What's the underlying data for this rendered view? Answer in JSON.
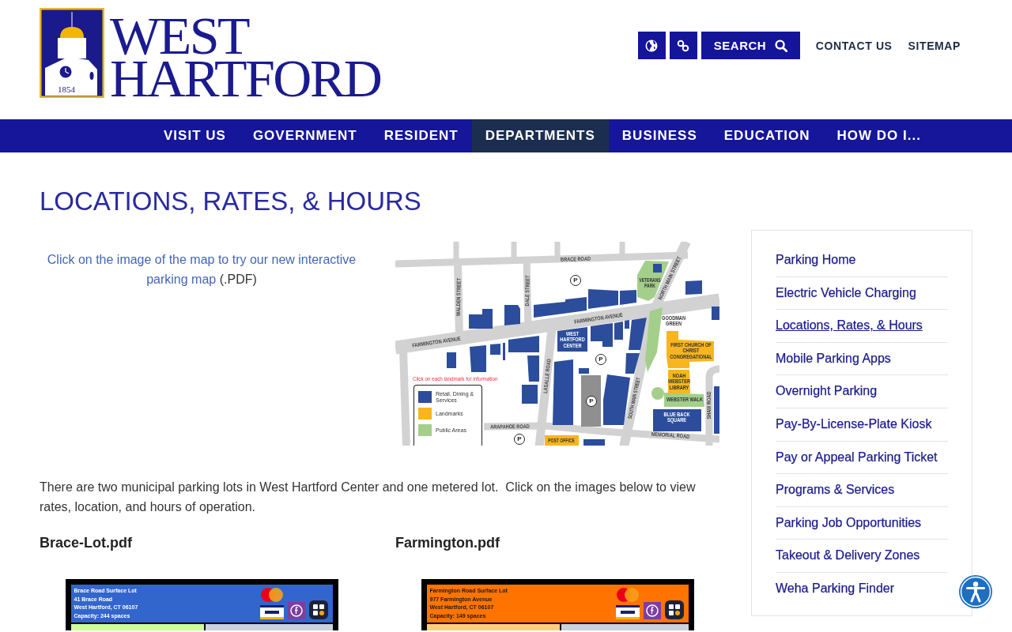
{
  "logo": {
    "line1": "WEST",
    "line2": "HARTFORD",
    "year": "1854"
  },
  "utility": {
    "search": "SEARCH",
    "links": [
      "CONTACT US",
      "SITEMAP"
    ]
  },
  "nav": [
    {
      "label": "VISIT US",
      "selected": false
    },
    {
      "label": "GOVERNMENT",
      "selected": false
    },
    {
      "label": "RESIDENT",
      "selected": false
    },
    {
      "label": "DEPARTMENTS",
      "selected": true
    },
    {
      "label": "BUSINESS",
      "selected": false
    },
    {
      "label": "EDUCATION",
      "selected": false
    },
    {
      "label": "HOW DO I...",
      "selected": false
    }
  ],
  "page_title": "LOCATIONS, RATES, & HOURS",
  "map_intro": {
    "link_lines": [
      "Click on the image of the map to try our new interactive",
      "parking map"
    ],
    "suffix": "(.PDF)"
  },
  "map": {
    "labels": [
      "BRACE ROAD",
      "WALDEN STREET",
      "DALE STREET",
      "VETERANS PARK",
      "NORTH MAIN STREET",
      "FARMINGTON AVENUE",
      "GOODMAN GREEN",
      "FARMINGTON AVENUE",
      "WEST HARTFORD CENTER",
      "FIRST CHURCH OF CHRIST CONGREGATIONAL",
      "LASALLE ROAD",
      "SOUTH MAIN STREET",
      "NOAH WEBSTER LIBRARY",
      "WEBSTER WALK",
      "BLUE BACK SQUARE",
      "SHAW ROAD",
      "ARAPAHOE ROAD",
      "MEMORIAL ROAD",
      "POST OFFICE"
    ],
    "parking_markers": [
      "P",
      "P",
      "P",
      "P"
    ],
    "note": "Click on each landmark for information",
    "legend": [
      {
        "label": "Retail, Dining & Services",
        "color": "#2b4d9b"
      },
      {
        "label": "Landmarks",
        "color": "#f8b51c"
      },
      {
        "label": "Public Areas",
        "color": "#a3cf8a"
      }
    ]
  },
  "description": "There are two municipal parking lots in West Hartford Center and one metered lot.  Click on the images below to view rates, location, and hours of operation.",
  "documents": [
    {
      "file": "Brace-Lot.pdf",
      "color": "#3366cc",
      "panel": {
        "color": "#ccff99"
      },
      "lines": [
        "Brace Road Surface Lot",
        "41 Brace Road",
        "West Hartford, CT 06107",
        "Capacity:  244 spaces"
      ]
    },
    {
      "file": "Farmington.pdf",
      "color": "#ff7300",
      "panel": {
        "color": "#ffcc80"
      },
      "lines": [
        "Farmington Road Surface Lot",
        "977 Farmington Avenue",
        "West Hartford, CT 06107",
        "Capacity:  149 spaces"
      ]
    }
  ],
  "sidebar": [
    {
      "label": "Parking Home",
      "selected": false
    },
    {
      "label": "Electric Vehicle Charging",
      "selected": false
    },
    {
      "label": "Locations, Rates, & Hours",
      "selected": true
    },
    {
      "label": "Mobile Parking Apps",
      "selected": false
    },
    {
      "label": "Overnight Parking",
      "selected": false
    },
    {
      "label": "Pay-By-License-Plate Kiosk",
      "selected": false
    },
    {
      "label": "Pay or Appeal Parking Ticket",
      "selected": false
    },
    {
      "label": "Programs & Services",
      "selected": false
    },
    {
      "label": "Parking Job Opportunities",
      "selected": false
    },
    {
      "label": "Takeout & Delivery Zones",
      "selected": false
    },
    {
      "label": "Weha Parking Finder",
      "selected": false
    }
  ]
}
